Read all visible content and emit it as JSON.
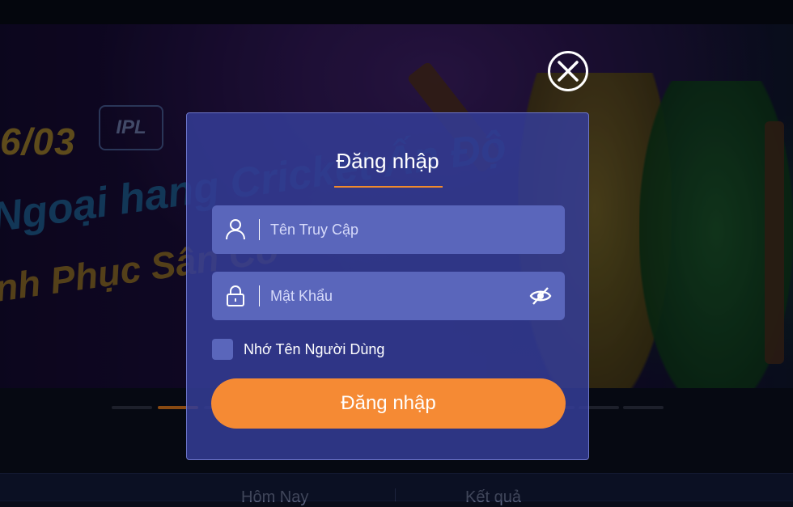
{
  "banner": {
    "date_text": "6/03",
    "badge_text": "IPL",
    "headline_line1": "Ngoại hang Cricket Ấn Độ",
    "headline_line2": "nh Phục Sân Cỏ",
    "slide_count": 8,
    "active_slide_index": 1
  },
  "bottom_nav": {
    "items": [
      {
        "label": "Hôm Nay"
      },
      {
        "label": "Kết quả"
      }
    ]
  },
  "login_modal": {
    "title": "Đăng nhập",
    "username_placeholder": "Tên Truy Cập",
    "username_value": "",
    "password_placeholder": "Mật Khẩu",
    "password_value": "",
    "remember_label": "Nhớ Tên Người Dùng",
    "remember_checked": false,
    "submit_label": "Đăng nhập"
  },
  "colors": {
    "accent": "#f58a34",
    "modal_bg": "#343c96",
    "field_bg": "#5a66bb",
    "text": "#ffffff"
  },
  "icons": {
    "close": "close-icon",
    "user": "user-icon",
    "lock": "lock-icon",
    "visibility": "eye-slash-icon"
  }
}
